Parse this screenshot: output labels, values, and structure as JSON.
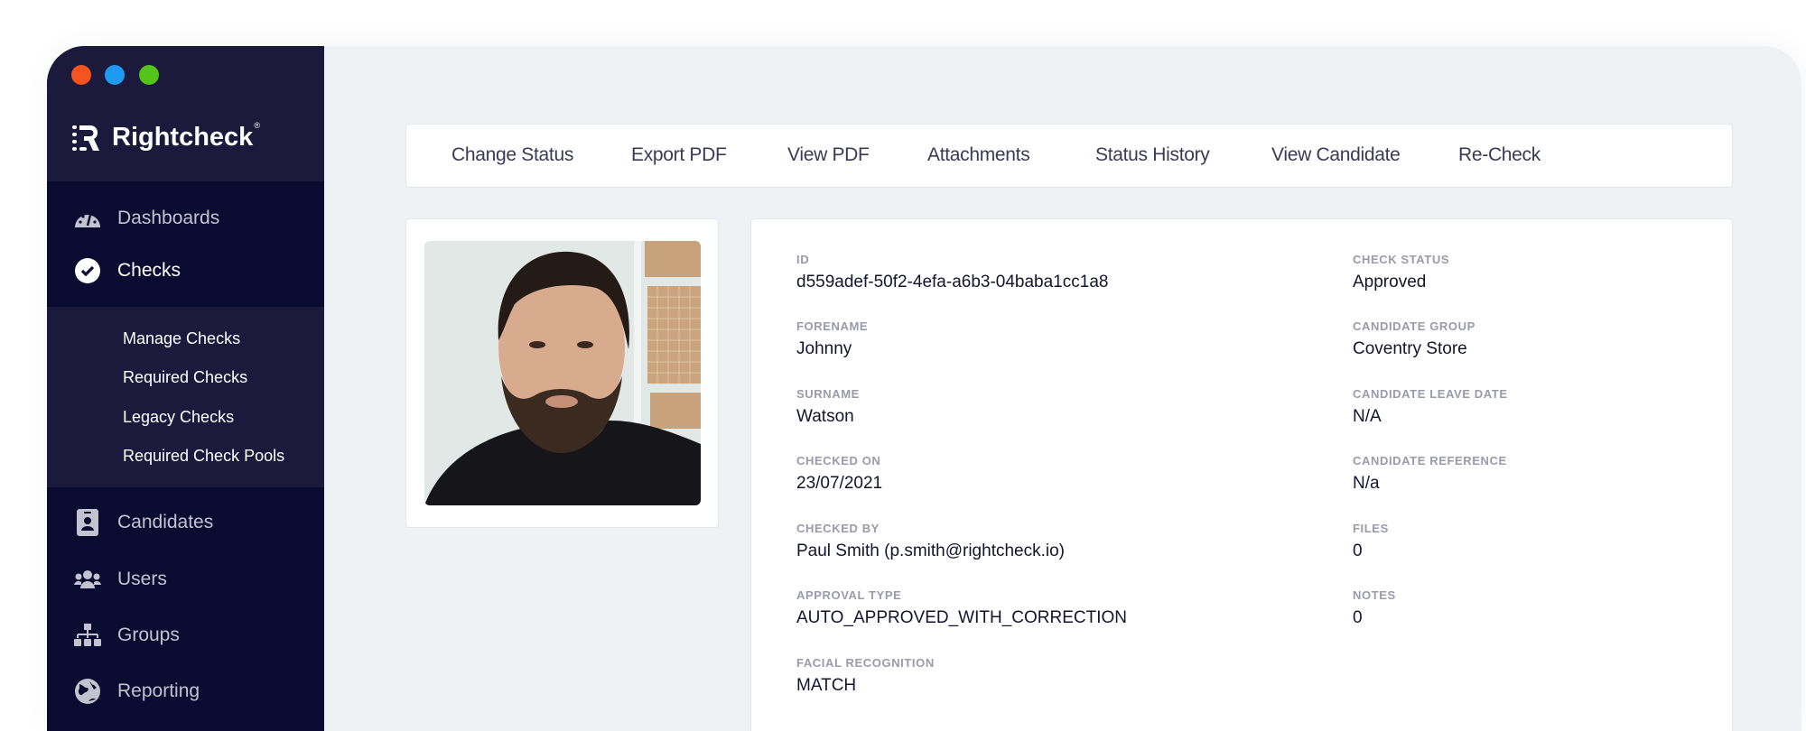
{
  "window": {
    "dots": [
      "#f5541f",
      "#1e9bf0",
      "#53c41a"
    ]
  },
  "brand": {
    "name": "Rightcheck",
    "registered": "®"
  },
  "sidebar": {
    "items": [
      {
        "label": "Dashboards",
        "icon": "dashboard-gauge-icon"
      },
      {
        "label": "Checks",
        "icon": "check-circle-icon"
      },
      {
        "label": "Candidates",
        "icon": "id-badge-icon"
      },
      {
        "label": "Users",
        "icon": "users-icon"
      },
      {
        "label": "Groups",
        "icon": "sitemap-icon"
      },
      {
        "label": "Reporting",
        "icon": "globe-icon"
      }
    ],
    "submenu": [
      "Manage Checks",
      "Required Checks",
      "Legacy Checks",
      "Required Check Pools"
    ]
  },
  "toolbar": [
    "Change Status",
    "Export PDF",
    "View PDF",
    "Attachments",
    "Status History",
    "View Candidate",
    "Re-Check"
  ],
  "details": {
    "left": [
      {
        "label": "ID",
        "value": "d559adef-50f2-4efa-a6b3-04baba1cc1a8"
      },
      {
        "label": "Forename",
        "value": "Johnny"
      },
      {
        "label": "Surname",
        "value": "Watson"
      },
      {
        "label": "Checked On",
        "value": "23/07/2021"
      },
      {
        "label": "Checked By",
        "value": "Paul  Smith (p.smith@rightcheck.io)"
      },
      {
        "label": "Approval Type",
        "value": "AUTO_APPROVED_WITH_CORRECTION"
      },
      {
        "label": "Facial Recognition",
        "value": "MATCH"
      }
    ],
    "right": [
      {
        "label": "Check Status",
        "value": "Approved"
      },
      {
        "label": "Candidate Group",
        "value": "Coventry Store"
      },
      {
        "label": "Candidate Leave Date",
        "value": "N/A"
      },
      {
        "label": "Candidate Reference",
        "value": "N/a"
      },
      {
        "label": "Files",
        "value": "0"
      },
      {
        "label": "Notes",
        "value": "0"
      }
    ]
  }
}
